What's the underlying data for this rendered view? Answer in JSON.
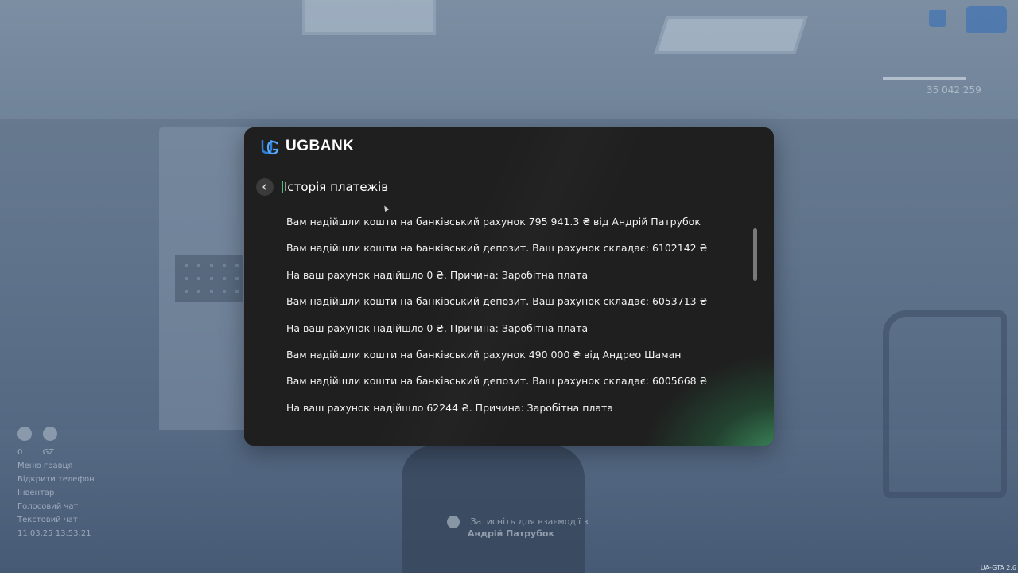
{
  "app": {
    "brand_name": "UGBANK",
    "accent_color": "#4ec27a",
    "logo_icon": "ugbank-logo-icon"
  },
  "header": {
    "back_icon": "chevron-left-icon",
    "title": "Історія платежів"
  },
  "transactions": [
    "Вам надійшли кошти на банківський рахунок 795 941.3 ₴ від Андрій Патрубок",
    "Вам надійшли кошти на банківський депозит. Ваш рахунок складає: 6102142 ₴",
    "На ваш рахунок надійшло 0 ₴. Причина: Заробітна плата",
    "Вам надійшли кошти на банківський депозит. Ваш рахунок складає: 6053713 ₴",
    "На ваш рахунок надійшло 0 ₴. Причина: Заробітна плата",
    "Вам надійшли кошти на банківський рахунок 490 000 ₴ від Андрео Шаман",
    "Вам надійшли кошти на банківський депозит. Ваш рахунок складає: 6005668 ₴",
    "На ваш рахунок надійшло 62244 ₴. Причина: Заробітна плата"
  ],
  "hud": {
    "money": "35 042 259",
    "left_counts": [
      "0",
      "GZ"
    ],
    "menu_items": [
      "Меню гравця",
      "Відкрити телефон",
      "Інвентар",
      "Голосовий чат",
      "Текстовий чат"
    ],
    "datetime": "11.03.25 13:53:21",
    "interact_hint": "Затисніть для взаємодії з",
    "interact_name": "Андрій Патрубок",
    "version": "UA-GTA 2.6"
  }
}
